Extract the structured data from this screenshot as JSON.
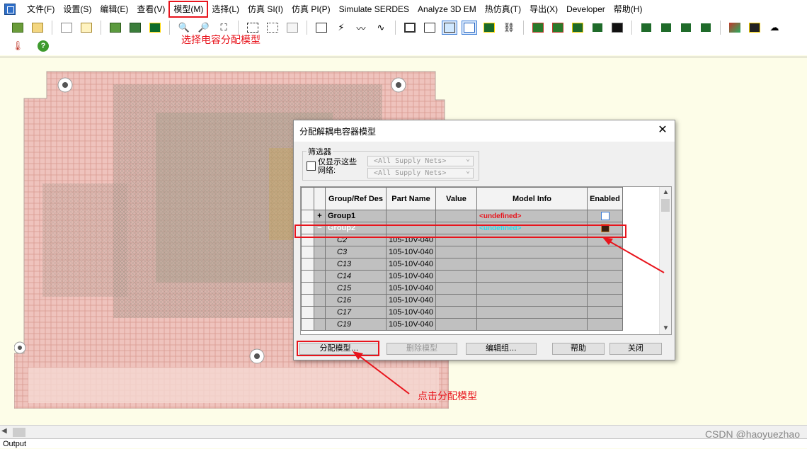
{
  "menu": [
    "文件(F)",
    "设置(S)",
    "编辑(E)",
    "查看(V)",
    "模型(M)",
    "选择(L)",
    "仿真 SI(I)",
    "仿真 PI(P)",
    "Simulate SERDES",
    "Analyze 3D EM",
    "热仿真(T)",
    "导出(X)",
    "Developer",
    "帮助(H)"
  ],
  "annotations": {
    "top": "选择电容分配模型",
    "bottom": "点击分配模型"
  },
  "colors": {
    "accent_red": "#e8141c",
    "selected_row": "#202020",
    "undefined_text": "#e8141c"
  },
  "dialog": {
    "title": "分配解耦电容器模型",
    "filter": {
      "legend": "筛选器",
      "checkbox_label": "仅显示这些网络:",
      "select1": "<All Supply Nets>",
      "select2": "<All Supply Nets>"
    },
    "columns": [
      "Group/Ref Des",
      "Part Name",
      "Value",
      "Model Info",
      "Enabled"
    ],
    "groups": [
      {
        "expander": "+",
        "name": "Group1",
        "model_info": "<undefined>",
        "enabled": true
      },
      {
        "expander": "−",
        "name": "Group2",
        "model_info": "<undefined>",
        "enabled": true
      }
    ],
    "rows": [
      {
        "ref": "C2",
        "part": "105-10V-040"
      },
      {
        "ref": "C3",
        "part": "105-10V-040"
      },
      {
        "ref": "C13",
        "part": "105-10V-040"
      },
      {
        "ref": "C14",
        "part": "105-10V-040"
      },
      {
        "ref": "C15",
        "part": "105-10V-040"
      },
      {
        "ref": "C16",
        "part": "105-10V-040"
      },
      {
        "ref": "C17",
        "part": "105-10V-040"
      },
      {
        "ref": "C19",
        "part": "105-10V-040"
      }
    ],
    "buttons": {
      "assign": "分配模型…",
      "delete": "删除模型",
      "edit_group": "编辑组…",
      "help": "帮助",
      "close": "关闭"
    }
  },
  "status": {
    "output_label": "Output"
  },
  "watermark": "CSDN @haoyuezhao"
}
